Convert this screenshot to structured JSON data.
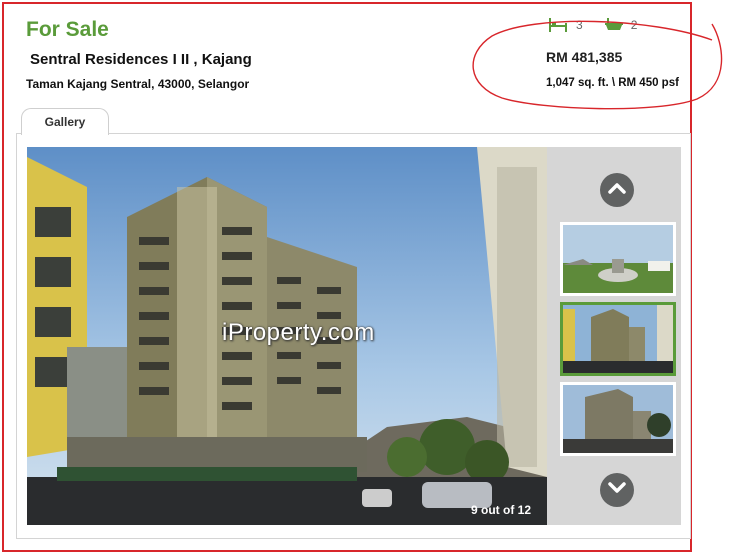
{
  "listing": {
    "status_label": "For Sale",
    "name": "Sentral Residences I II , Kajang",
    "address": "Taman Kajang Sentral, 43000, Selangor",
    "bedrooms": "3",
    "bathrooms": "2",
    "price": "RM 481,385",
    "size": "1,047 sq. ft. \\ RM 450 psf"
  },
  "gallery": {
    "tab_label": "Gallery",
    "watermark": "iProperty.com",
    "counter": "9 out of 12",
    "current_index": 9,
    "total": 12,
    "thumbnails": [
      "rooftop-garden-photo",
      "building-front-photo",
      "building-dusk-photo"
    ],
    "active_thumbnail": 1
  },
  "icons": {
    "bed": "bed-icon",
    "bath": "bathtub-icon",
    "prev": "chevron-up-icon",
    "next": "chevron-down-icon"
  },
  "colors": {
    "accent_green": "#5a9b3a",
    "annotation_red": "#d8262b",
    "arrow_button": "#606262"
  }
}
